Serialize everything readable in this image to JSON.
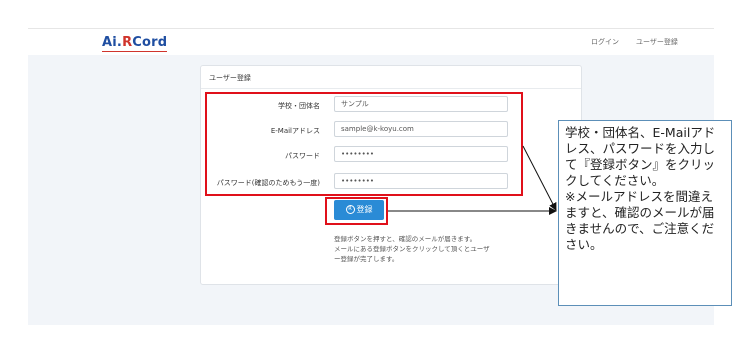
{
  "navbar": {
    "logo_ai": "Ai.",
    "logo_r": "R",
    "logo_cord": "Cord",
    "login_link": "ログイン",
    "register_link": "ユーザー登録"
  },
  "form": {
    "title": "ユーザー登録",
    "fields": [
      {
        "label": "学校・団体名",
        "value": "サンプル"
      },
      {
        "label": "E-Mailアドレス",
        "value": "sample@k-koyu.com"
      },
      {
        "label": "パスワード",
        "value": "••••••••"
      },
      {
        "label": "パスワード(確認のためもう一度)",
        "value": "••••••••"
      }
    ],
    "submit_label": "登録",
    "submit_icon": "circle-icon",
    "help_lines": [
      "登録ボタンを押すと、確認のメールが届きます。",
      "メールにある登録ボタンをクリックして頂くとユーザ",
      "ー登録が完了します。"
    ]
  },
  "callout": {
    "text_1": "学校・団体名、E-Mailアドレス、パスワードを入力して『登録ボタン』をクリックしてください。",
    "text_2": "※メールアドレスを間違えますと、確認のメールが届きませんので、ご注意ください。"
  },
  "colors": {
    "highlight": "#e0101a",
    "button": "#2a8bd6",
    "callout_border": "#5c8fb8"
  }
}
